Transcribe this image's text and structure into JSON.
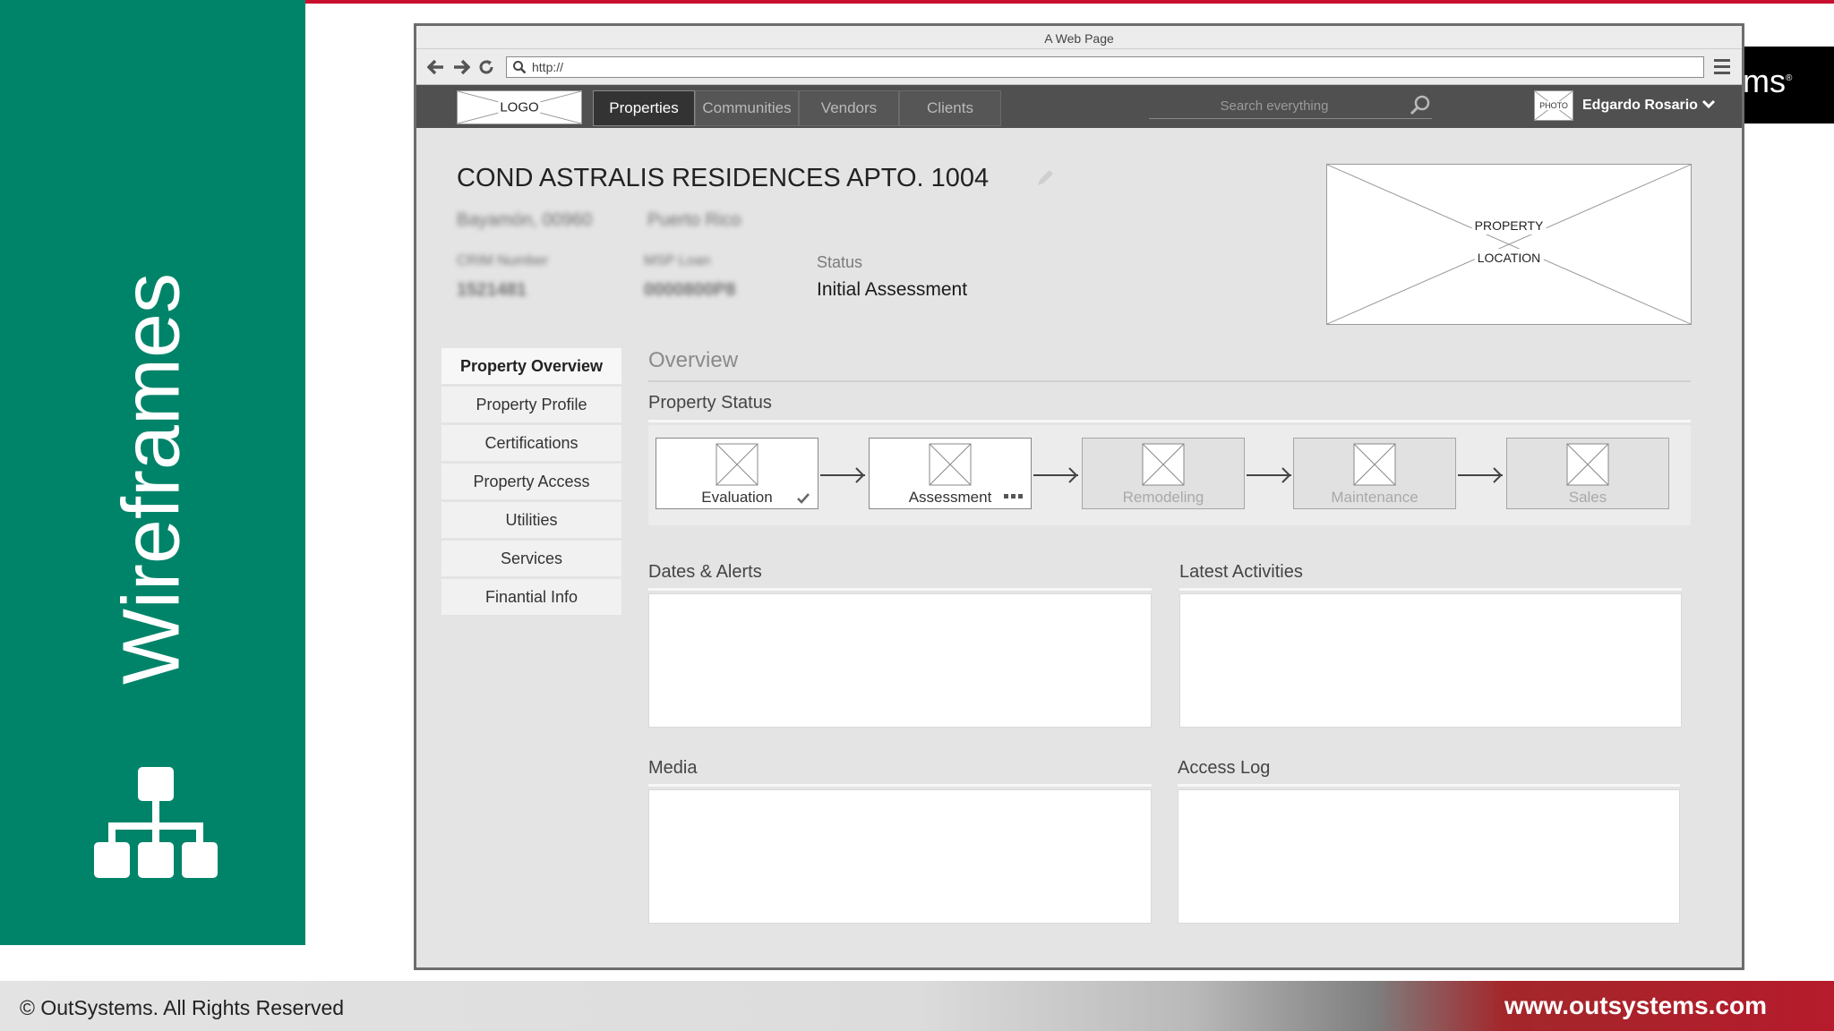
{
  "slide": {
    "title": "Wireframes",
    "footer_left": "© OutSystems. All Rights Reserved",
    "footer_right": "www.outsystems.com",
    "brand_fragment": "ms",
    "brand_mark": "®",
    "colors": {
      "panel": "#008469",
      "accent_red": "#c8102e",
      "footer_red": "#b61b2b"
    }
  },
  "browser": {
    "window_title": "A Web Page",
    "url": "http://",
    "buttons": {
      "back": "back-arrow-icon",
      "forward": "forward-arrow-icon",
      "reload": "reload-icon",
      "menu": "hamburger-menu-icon"
    }
  },
  "app": {
    "logo": "LOGO",
    "nav": [
      {
        "label": "Properties",
        "active": true
      },
      {
        "label": "Communities",
        "active": false
      },
      {
        "label": "Vendors",
        "active": false
      },
      {
        "label": "Clients",
        "active": false
      }
    ],
    "search_placeholder": "Search everything",
    "photo": "PHOTO",
    "user": "Edgardo Rosario"
  },
  "property": {
    "title": "COND ASTRALIS RESIDENCES APTO. 1004",
    "blurred": {
      "city": "Bayamón, 00960",
      "country": "Puerto Rico",
      "label_1": "CRIM Number",
      "label_2": "MSP Loan",
      "value_1": "1521481",
      "value_2": "0000800P8"
    },
    "status_label": "Status",
    "status_value": "Initial Assessment",
    "map": {
      "line1": "PROPERTY",
      "line2": "LOCATION"
    }
  },
  "side_menu": [
    {
      "label": "Property Overview",
      "active": true
    },
    {
      "label": "Property Profile",
      "active": false
    },
    {
      "label": "Certifications",
      "active": false
    },
    {
      "label": "Property Access",
      "active": false
    },
    {
      "label": "Utilities",
      "active": false
    },
    {
      "label": "Services",
      "active": false
    },
    {
      "label": "Finantial Info",
      "active": false
    }
  ],
  "overview": {
    "heading": "Overview",
    "property_status": "Property Status",
    "steps": [
      {
        "label": "Evaluation",
        "state": "done"
      },
      {
        "label": "Assessment",
        "state": "current"
      },
      {
        "label": "Remodeling",
        "state": "todo"
      },
      {
        "label": "Maintenance",
        "state": "todo"
      },
      {
        "label": "Sales",
        "state": "todo"
      }
    ],
    "panels": {
      "dates_alerts": "Dates & Alerts",
      "latest_activities": "Latest Activities",
      "media": "Media",
      "access_log": "Access Log"
    }
  }
}
